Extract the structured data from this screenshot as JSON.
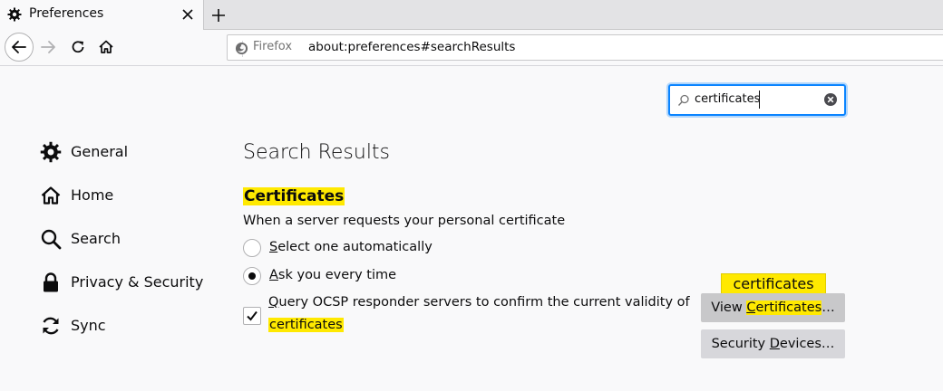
{
  "tabs": [
    {
      "title": "Preferences",
      "icon": "gear-icon"
    }
  ],
  "navbar": {
    "identity_label": "Firefox",
    "url": "about:preferences#searchResults"
  },
  "search": {
    "value": "certificates"
  },
  "sidebar": {
    "items": [
      {
        "label": "General",
        "icon": "gear-icon"
      },
      {
        "label": "Home",
        "icon": "home-icon"
      },
      {
        "label": "Search",
        "icon": "search-icon"
      },
      {
        "label": "Privacy & Security",
        "icon": "lock-icon"
      },
      {
        "label": "Sync",
        "icon": "sync-icon"
      }
    ]
  },
  "main": {
    "results_title": "Search Results",
    "section_heading": "Certificates",
    "description": "When a server requests your personal certificate",
    "options": [
      {
        "label_first": "S",
        "label_rest": "elect one automatically",
        "selected": false
      },
      {
        "label_first": "A",
        "label_rest": "sk you every time",
        "selected": true
      }
    ],
    "ocsp": {
      "line1_first": "Q",
      "line1_rest": "uery OCSP responder servers to confirm the current validity of",
      "line2": "certificates",
      "checked": true
    },
    "tooltip": "certificates",
    "buttons": {
      "view_pre": "View ",
      "view_access": "C",
      "view_highlight": "ertificates",
      "view_post": "…",
      "devices_pre": "Security ",
      "devices_access": "D",
      "devices_post": "evices…"
    }
  },
  "colors": {
    "highlight": "#ffe900",
    "focus_ring": "#0a84ff",
    "button_bg": "#d7d7db"
  }
}
